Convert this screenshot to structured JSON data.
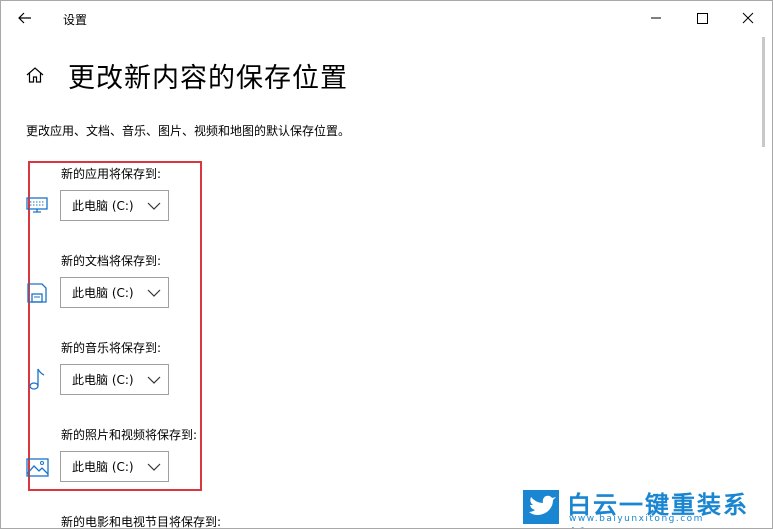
{
  "window": {
    "title": "设置"
  },
  "page": {
    "heading": "更改新内容的保存位置",
    "description": "更改应用、文档、音乐、图片、视频和地图的默认保存位置。"
  },
  "sections": [
    {
      "label": "新的应用将保存到:",
      "value": "此电脑 (C:)",
      "icon": "monitor-icon"
    },
    {
      "label": "新的文档将保存到:",
      "value": "此电脑 (C:)",
      "icon": "document-drive-icon"
    },
    {
      "label": "新的音乐将保存到:",
      "value": "此电脑 (C:)",
      "icon": "music-note-icon"
    },
    {
      "label": "新的照片和视频将保存到:",
      "value": "此电脑 (C:)",
      "icon": "picture-icon"
    },
    {
      "label": "新的电影和电视节目将保存到:"
    }
  ],
  "watermark": {
    "name": "白云一键重装系统",
    "url": "www.baiyunxitong.com"
  },
  "colors": {
    "accent": "#1a73c8",
    "highlight_border": "#d9363e",
    "watermark": "#1a86d2"
  }
}
